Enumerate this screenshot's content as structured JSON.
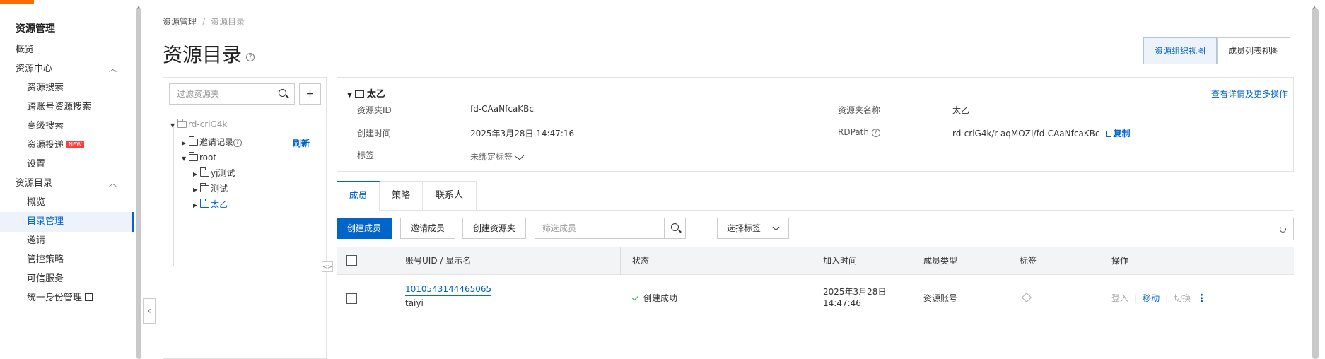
{
  "sidebar": {
    "title": "资源管理",
    "items": [
      {
        "label": "概览"
      },
      {
        "label": "资源中心",
        "chevron": "︿"
      },
      {
        "label": "资源搜索"
      },
      {
        "label": "跨账号资源搜索"
      },
      {
        "label": "高级搜索"
      },
      {
        "label": "资源投递",
        "badge": "NEW"
      },
      {
        "label": "设置"
      },
      {
        "label": "资源目录",
        "chevron": "︿"
      },
      {
        "label": "概览"
      },
      {
        "label": "目录管理"
      },
      {
        "label": "邀请"
      },
      {
        "label": "管控策略"
      },
      {
        "label": "可信服务"
      },
      {
        "label": "统一身份管理"
      }
    ]
  },
  "breadcrumb": {
    "root": "资源管理",
    "sep": "/",
    "current": "资源目录"
  },
  "page_title": "资源目录",
  "help_glyph": "?",
  "view_toggle": {
    "org_view": "资源组织视图",
    "member_view": "成员列表视图"
  },
  "tree": {
    "search_placeholder": "过滤资源夹",
    "add_glyph": "+",
    "refresh": "刷新",
    "nodes": [
      {
        "label": "rd-crlG4k"
      },
      {
        "label": "邀请记录"
      },
      {
        "label": "root"
      },
      {
        "label": "yj测试"
      },
      {
        "label": "测试"
      },
      {
        "label": "太乙"
      }
    ]
  },
  "info": {
    "name": "太乙",
    "more_link": "查看详情及更多操作",
    "folder_id_label": "资源夹ID",
    "folder_id": "fd-CAaNfcaKBc",
    "created_label": "创建时间",
    "created": "2025年3月28日 14:47:16",
    "tag_label": "标签",
    "tag_value": "未绑定标签",
    "folder_name_label": "资源夹名称",
    "folder_name": "太乙",
    "rdpath_label": "RDPath",
    "rdpath": "rd-crlG4k/r-aqMOZI/fd-CAaNfcaKBc",
    "copy": "复制"
  },
  "tabs": [
    {
      "label": "成员"
    },
    {
      "label": "策略"
    },
    {
      "label": "联系人"
    }
  ],
  "toolbar": {
    "create_member": "创建成员",
    "invite_member": "邀请成员",
    "create_folder": "创建资源夹",
    "filter_placeholder": "筛选成员",
    "select_tag": "选择标签"
  },
  "table": {
    "headers": {
      "uid": "账号UID / 显示名",
      "status": "状态",
      "joined": "加入时间",
      "type": "成员类型",
      "tags": "标签",
      "ops": "操作"
    },
    "rows": [
      {
        "uid": "1010543144465065",
        "display_name": "taiyi",
        "status": "创建成功",
        "joined_date": "2025年3月28日",
        "joined_time": "14:47:46",
        "type": "资源账号",
        "ops": {
          "login": "登入",
          "move": "移动",
          "switch": "切换"
        }
      }
    ]
  },
  "colors": {
    "accent": "#0064c8",
    "brand": "#ff6a00",
    "success": "#1ea63a"
  }
}
